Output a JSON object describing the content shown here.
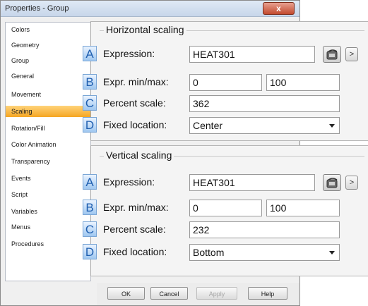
{
  "window": {
    "title": "Properties - Group",
    "close_label": "x"
  },
  "sidebar": {
    "items": [
      {
        "label": "Colors"
      },
      {
        "label": "Geometry"
      },
      {
        "label": "Group"
      },
      {
        "label": "General"
      },
      {
        "label": "Movement"
      },
      {
        "label": "Scaling",
        "selected": true
      },
      {
        "label": "Rotation/Fill"
      },
      {
        "label": "Color Animation"
      },
      {
        "label": "Transparency"
      },
      {
        "label": "Events"
      },
      {
        "label": "Script"
      },
      {
        "label": "Variables"
      },
      {
        "label": "Menus"
      },
      {
        "label": "Procedures"
      }
    ]
  },
  "horizontal": {
    "title": "Horizontal scaling",
    "expression_label": "Expression:",
    "expression_value": "HEAT301",
    "minmax_label": "Expr. min/max:",
    "min_value": "0",
    "max_value": "100",
    "percent_label": "Percent scale:",
    "percent_value": "362",
    "fixed_label": "Fixed location:",
    "fixed_value": "Center"
  },
  "vertical": {
    "title": "Vertical scaling",
    "expression_label": "Expression:",
    "expression_value": "HEAT301",
    "minmax_label": "Expr. min/max:",
    "min_value": "0",
    "max_value": "100",
    "percent_label": "Percent scale:",
    "percent_value": "232",
    "fixed_label": "Fixed location:",
    "fixed_value": "Bottom"
  },
  "badges": {
    "a": "A",
    "b": "B",
    "c": "C",
    "d": "D"
  },
  "expand_glyph": ">",
  "buttons": {
    "ok": "OK",
    "cancel": "Cancel",
    "apply": "Apply",
    "help": "Help"
  },
  "colors": {
    "selection": "#f5a623",
    "badge_text": "#1f5fb0",
    "close": "#c24a2e"
  }
}
